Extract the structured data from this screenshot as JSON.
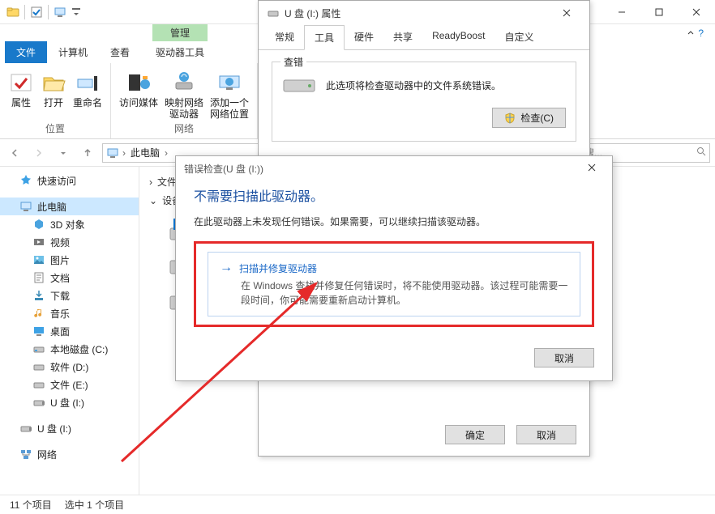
{
  "window": {
    "title": "此电脑"
  },
  "tabs": {
    "file": "文件",
    "computer": "计算机",
    "view": "查看",
    "context": "管理",
    "context_sub": "驱动器工具"
  },
  "ribbon": {
    "group1": {
      "name": "位置",
      "items": [
        "属性",
        "打开",
        "重命名"
      ]
    },
    "group2": {
      "name": "网络",
      "items": [
        "访问媒体",
        "映射网络\n驱动器",
        "添加一个\n网络位置"
      ]
    }
  },
  "addr": {
    "root": "此电脑",
    "search_ph": "搜..."
  },
  "nav": {
    "quick": "快速访问",
    "thispc": "此电脑",
    "items": [
      "3D 对象",
      "视频",
      "图片",
      "文档",
      "下载",
      "音乐",
      "桌面",
      "本地磁盘 (C:)",
      "软件 (D:)",
      "文件 (E:)",
      "U 盘 (I:)"
    ],
    "usb_again": "U 盘 (I:)",
    "network": "网络"
  },
  "content": {
    "sec1": "文件夹",
    "sec2": "设备和驱动器"
  },
  "status": {
    "count": "11 个项目",
    "selected": "选中 1 个项目"
  },
  "propDlg": {
    "title": "U 盘 (I:) 属性",
    "tabs": [
      "常规",
      "工具",
      "硬件",
      "共享",
      "ReadyBoost",
      "自定义"
    ],
    "active": 1,
    "group": "查错",
    "desc": "此选项将检查驱动器中的文件系统错误。",
    "check_btn": "检查(C)",
    "ok": "确定",
    "cancel": "取消"
  },
  "errDlg": {
    "title": "错误检查(U 盘 (I:))",
    "heading": "不需要扫描此驱动器。",
    "para": "在此驱动器上未发现任何错误。如果需要，可以继续扫描该驱动器。",
    "scan_title": "扫描并修复驱动器",
    "scan_desc": "在 Windows 查找并修复任何错误时，将不能使用驱动器。该过程可能需要一段时间，你可能需要重新启动计算机。",
    "cancel": "取消"
  }
}
